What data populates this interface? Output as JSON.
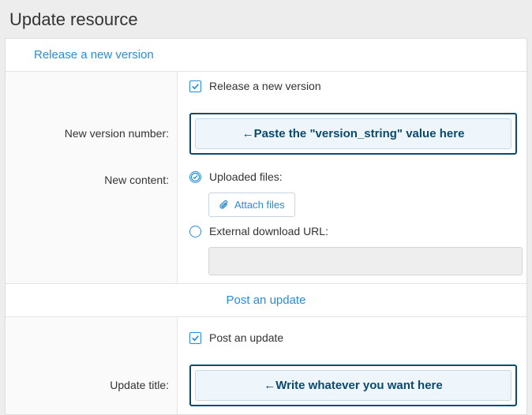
{
  "pageTitle": "Update resource",
  "section1": {
    "header": "Release a new version",
    "checkboxLabel": "Release a new version",
    "versionLabel": "New version number:",
    "versionPlaceholder": "←Paste the \"version_string\" value here",
    "contentLabel": "New content:",
    "uploadedLabel": "Uploaded files:",
    "attachLabel": "Attach files",
    "externalLabel": "External download URL:"
  },
  "section2": {
    "header": "Post an update",
    "checkboxLabel": "Post an update",
    "titleLabel": "Update title:",
    "titlePlaceholder": "←Write whatever you want here"
  }
}
